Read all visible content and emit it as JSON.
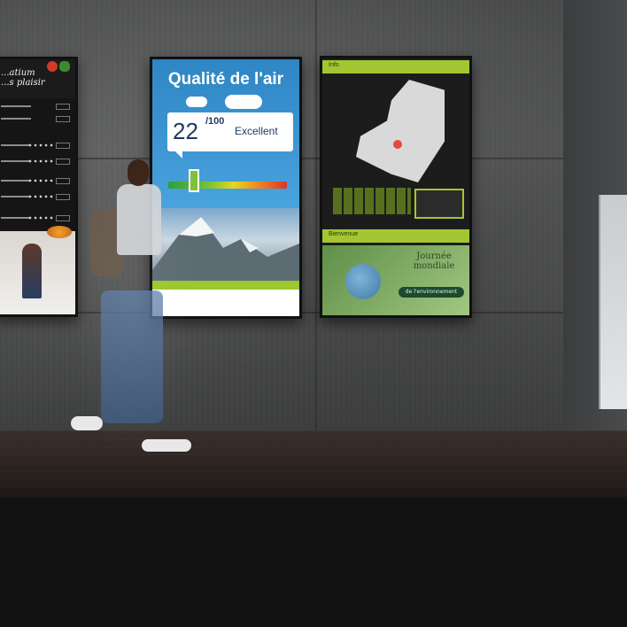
{
  "scene": {
    "description_colors": {
      "wall": "#555656",
      "floor": "#2a221f",
      "accent_green": "#a3c733",
      "sky_blue": "#2e86c4"
    }
  },
  "screen_menu": {
    "title_line1": "...atium",
    "title_line2": "...s plaisir"
  },
  "screen_air": {
    "title": "Qualité de l'air",
    "score": "22",
    "scale": "/100",
    "status": "Excellent",
    "gauge_level": 0.22
  },
  "screen_map": {
    "top_bar_label": "Info",
    "bottom_bar_label": "Bienvenue",
    "event_title_line1": "Journée",
    "event_title_line2": "mondiale",
    "event_title_line3": "de l'environnement"
  }
}
